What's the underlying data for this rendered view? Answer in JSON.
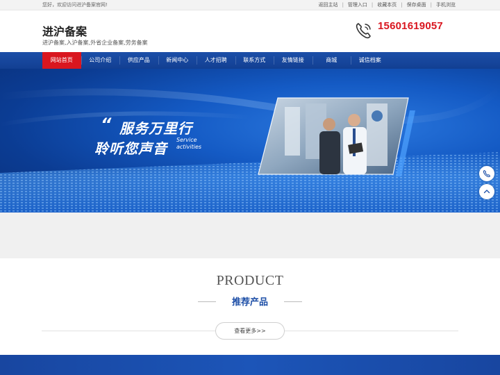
{
  "topbar": {
    "welcome": "您好，欢迎访问进沪备案官网!",
    "links": [
      "返回主站",
      "管理入口",
      "收藏本页",
      "保存桌面",
      "手机浏览"
    ]
  },
  "header": {
    "title": "进沪备案",
    "subtitle": "进沪备案,入沪备案,外省企业备案,劳务备案",
    "phone": "15601619057"
  },
  "nav": {
    "items": [
      "网站首页",
      "公司介绍",
      "供应产品",
      "新闻中心",
      "人才招聘",
      "联系方式",
      "友情链接",
      "商城",
      "诚信档案"
    ]
  },
  "banner": {
    "quote_mark": "“",
    "line1": "服务万里行",
    "line2": "聆听您声音",
    "english_1": "Service",
    "english_2": "activities"
  },
  "product": {
    "title_en": "PRODUCT",
    "title_cn": "推荐产品",
    "more_label": "查看更多>>"
  },
  "colors": {
    "brand_blue": "#1c4fa8",
    "accent_red": "#d9161f"
  }
}
